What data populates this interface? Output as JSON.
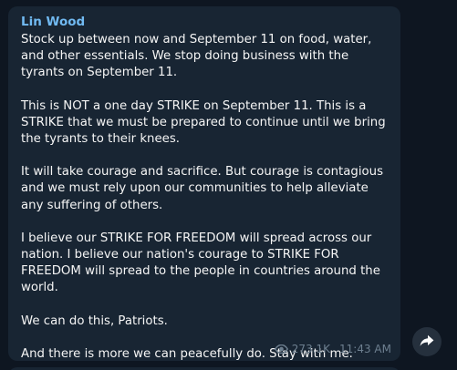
{
  "message": {
    "author": "Lin Wood",
    "paragraphs": [
      "Stock up between now and September 11 on food, water, and other essentials. We stop doing business with the tyrants on September 11.",
      "This is NOT a one day STRIKE on September 11. This is a STRIKE that we must be prepared to continue until we bring the tyrants to their knees.",
      "It will take courage and sacrifice. But courage is contagious and we must rely upon our communities to help alleviate any suffering of others.",
      "I believe our STRIKE FOR FREEDOM will spread across our nation. I believe our nation's courage to STRIKE FOR FREEDOM will spread to the people in countries around the world.",
      "We can do this, Patriots.",
      "And there is more we can peacefully do. Stay with me."
    ],
    "views": "273.1K",
    "time": "11:43 AM"
  },
  "icons": {
    "views": "eye-icon",
    "share": "share-arrow-icon"
  },
  "colors": {
    "background": "#0e1621",
    "bubble": "#182533",
    "author": "#71baf2",
    "text": "#f5f5f5",
    "meta": "#6d7f8f"
  }
}
